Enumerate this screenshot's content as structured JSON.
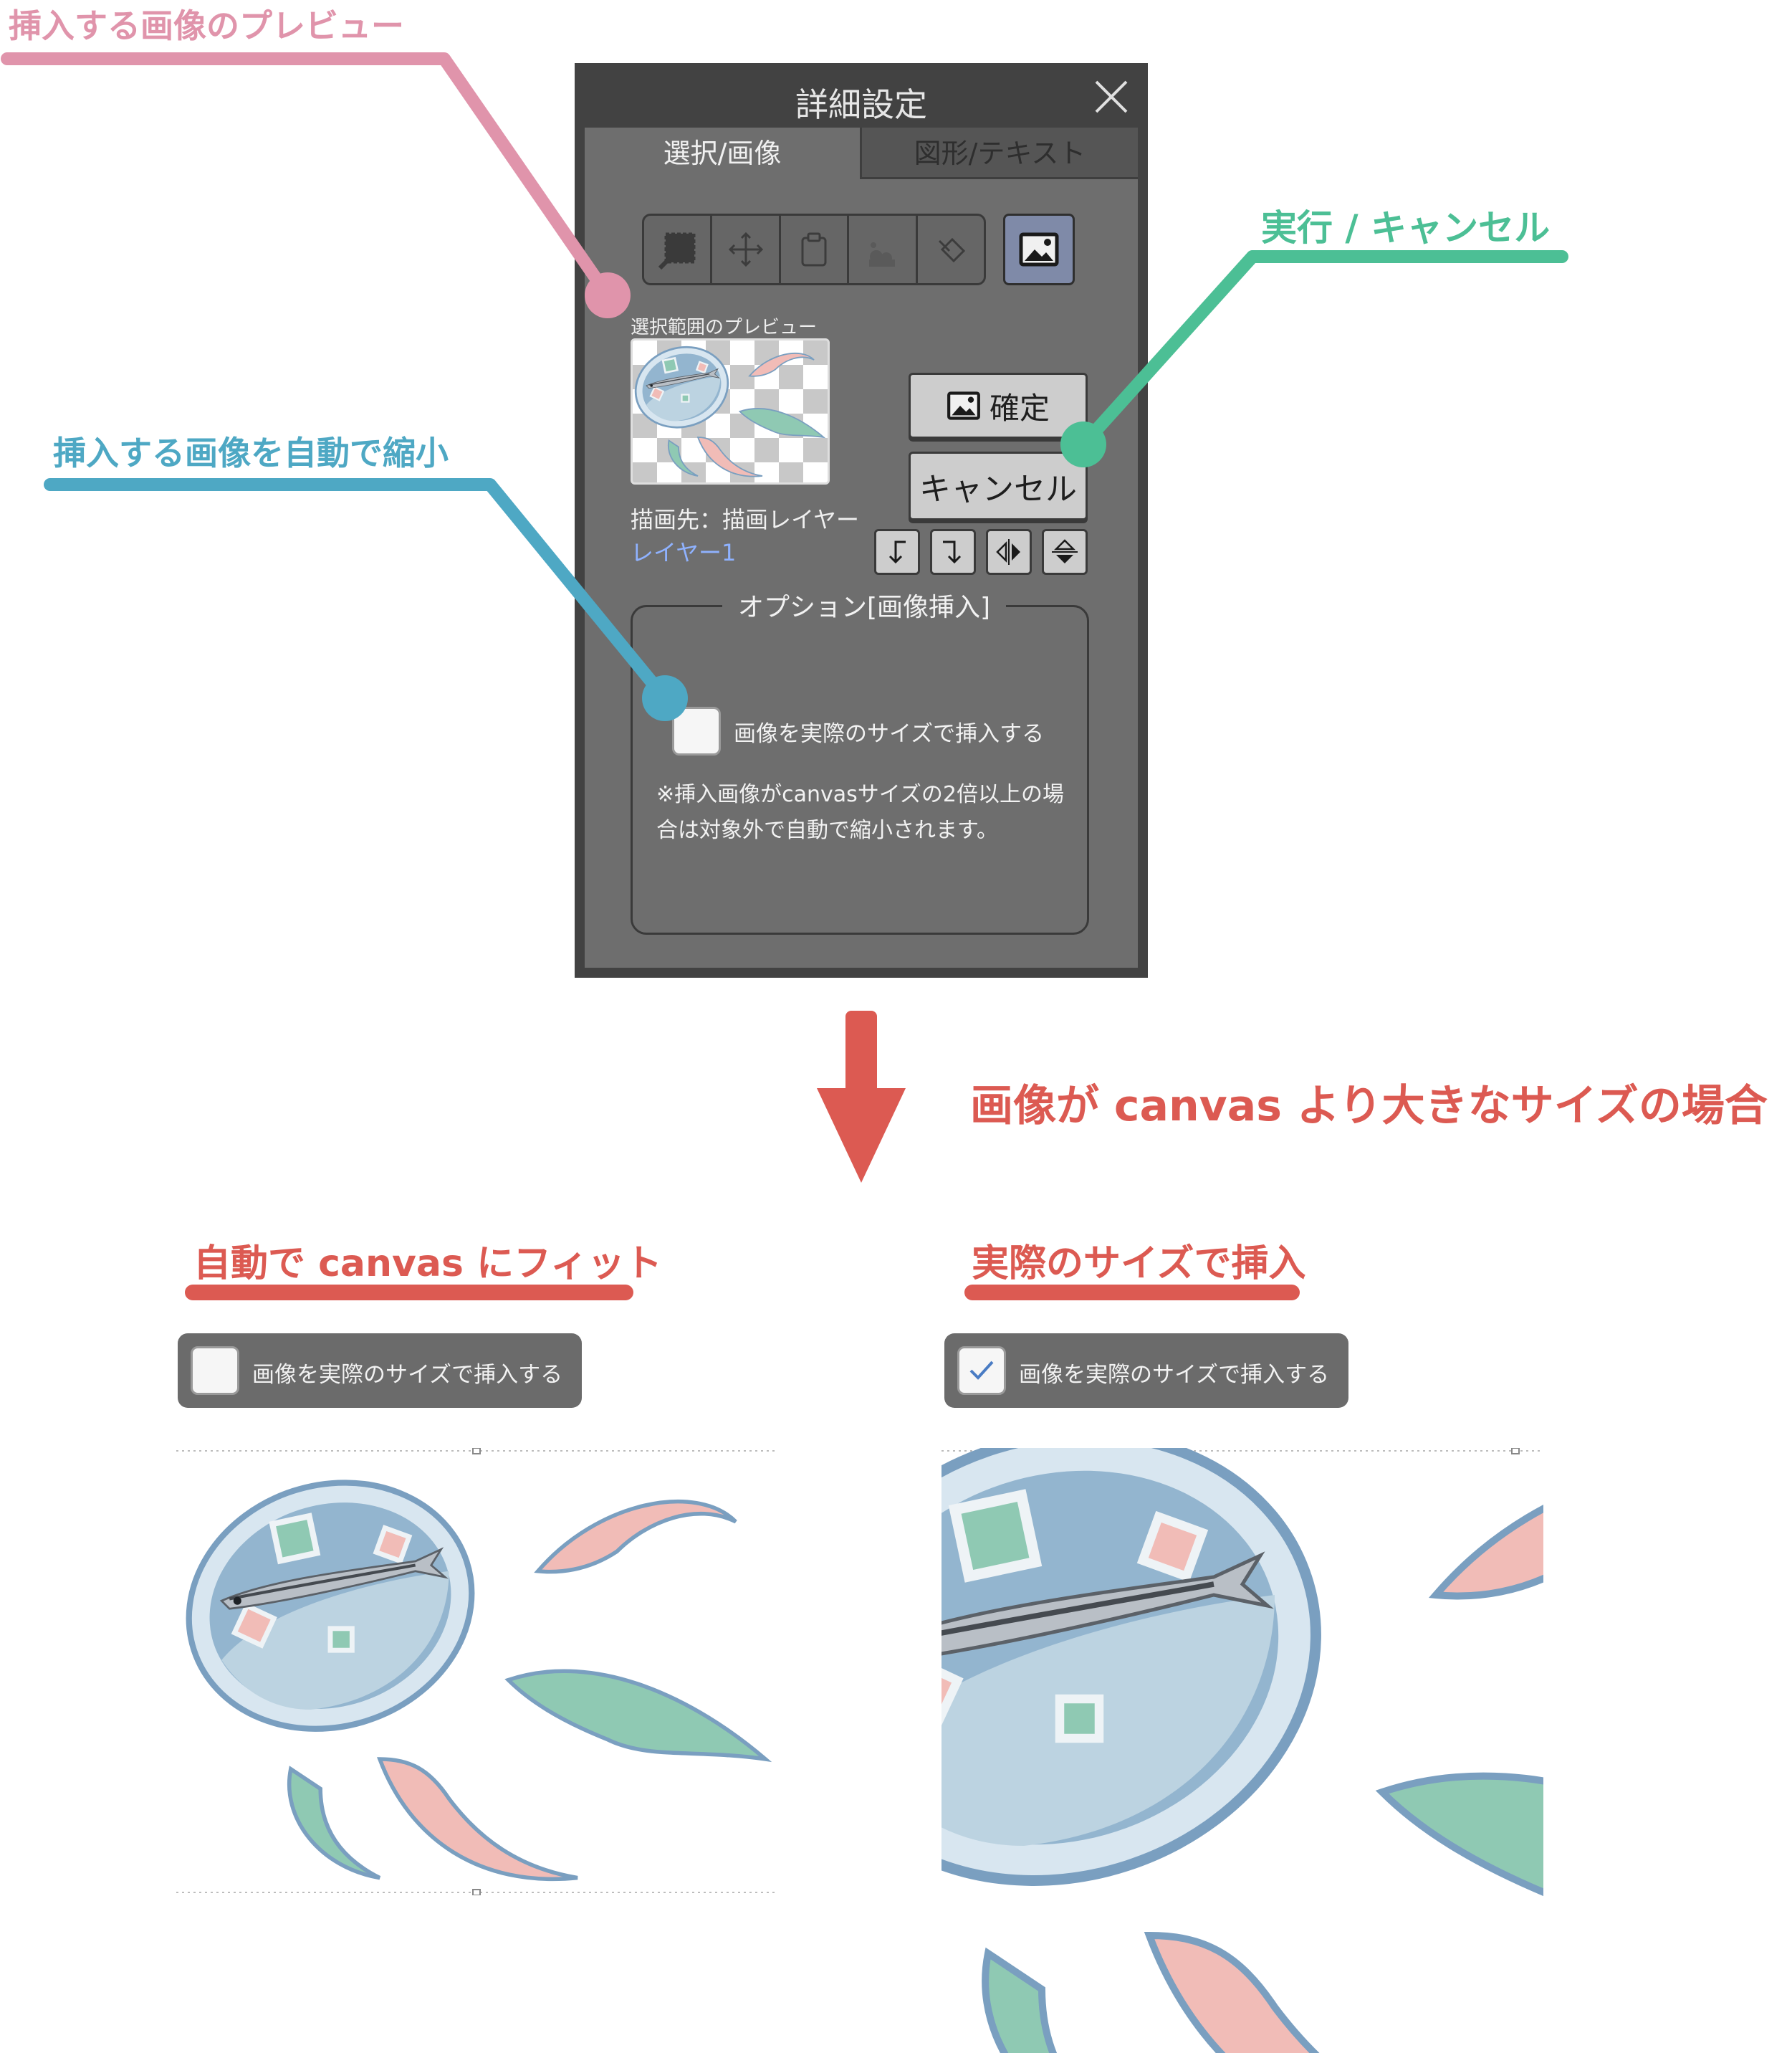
{
  "annotations": {
    "preview_callout": {
      "label": "挿入する画像のプレビュー",
      "color": "#e094ab"
    },
    "auto_shrink_callout": {
      "label": "挿入する画像を自動で縮小",
      "color": "#4ea8c4"
    },
    "execute_callout": {
      "label": "実行 / キャンセル",
      "color": "#4cbf95"
    }
  },
  "dialog": {
    "title": "詳細設定",
    "close_icon": "close-icon",
    "tabs": [
      {
        "label": "選択/画像",
        "active": true
      },
      {
        "label": "図形/テキスト",
        "active": false
      }
    ],
    "toolbar": {
      "tools": [
        "select-rect-icon",
        "move-icon",
        "paste-icon",
        "blur-icon",
        "fill-icon"
      ],
      "active_tool": "image-icon"
    },
    "preview": {
      "label": "選択範囲のプレビュー"
    },
    "target": {
      "label": "描画先：描画レイヤー",
      "layer": "レイヤー1"
    },
    "buttons": {
      "confirm": "確定",
      "cancel": "キャンセル"
    },
    "transform_buttons": [
      "rotate-left-icon",
      "rotate-right-icon",
      "flip-horizontal-icon",
      "flip-vertical-icon"
    ],
    "options": {
      "title": "オプション[画像挿入]",
      "checkbox_label": "画像を実際のサイズで挿入する",
      "checked": false,
      "note": "※挿入画像がcanvasサイズの2倍以上の場合は対象外で自動で縮小されます。"
    }
  },
  "arrow_caption": "画像が canvas より大きなサイズの場合",
  "examples": {
    "fit": {
      "title": "自動で canvas にフィット",
      "checkbox_label": "画像を実際のサイズで挿入する",
      "checked": false
    },
    "actual": {
      "title": "実際のサイズで挿入",
      "checkbox_label": "画像を実際のサイズで挿入する",
      "checked": true
    }
  },
  "colors": {
    "accent_red": "#dc5a52",
    "teal": "#8fc9b3",
    "pink": "#f1bcb7",
    "blue_ring": "#7a9fc0",
    "bubble_fill": "#b7cfdf"
  }
}
